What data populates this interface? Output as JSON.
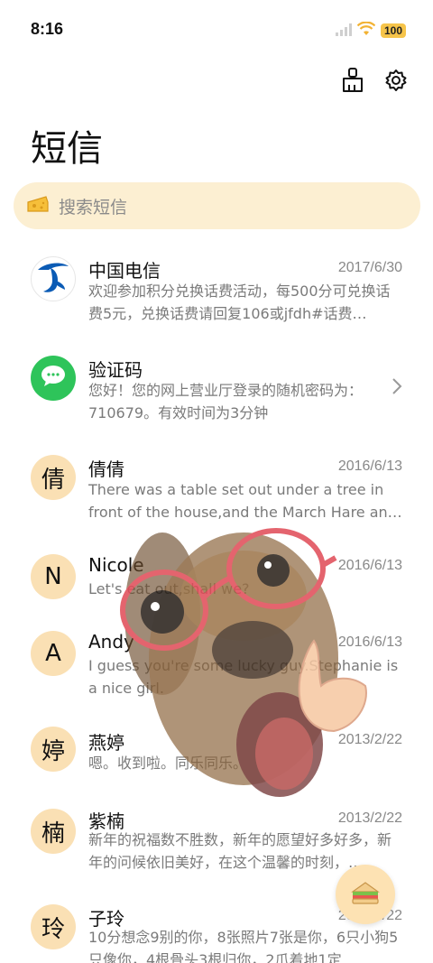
{
  "status_bar": {
    "time": "8:16",
    "battery": "100"
  },
  "header": {
    "title": "短信"
  },
  "search": {
    "placeholder": "搜索短信"
  },
  "messages": [
    {
      "sender": "中国电信",
      "date": "2017/6/30",
      "preview": "欢迎参加积分兑换话费活动，每500分可兑换话费5元，兑换话费请回复106或jfdh#话费…",
      "avatar": ""
    },
    {
      "sender": "验证码",
      "date": "",
      "preview": "您好！您的网上营业厅登录的随机密码为：710679。有效时间为3分钟",
      "avatar": ""
    },
    {
      "sender": "倩倩",
      "date": "2016/6/13",
      "preview": "There was a table set out under a tree in front of the house,and the March Hare an…",
      "avatar": "倩"
    },
    {
      "sender": "Nicole",
      "date": "2016/6/13",
      "preview": "Let's eat out,shall we?",
      "avatar": "N"
    },
    {
      "sender": "Andy",
      "date": "2016/6/13",
      "preview": "I guess you're some lucky guy.Stephanie is a nice girl.",
      "avatar": "A"
    },
    {
      "sender": "燕婷",
      "date": "2013/2/22",
      "preview": "嗯。收到啦。同乐同乐。",
      "avatar": "婷"
    },
    {
      "sender": "紫楠",
      "date": "2013/2/22",
      "preview": "新年的祝福数不胜数，新年的愿望好多好多，新年的问候依旧美好，在这个温馨的时刻，…",
      "avatar": "楠"
    },
    {
      "sender": "子玲",
      "date": "2013/2/22",
      "preview": "10分想念9别的你，8张照片7张是你，6只小狗5只像你，4根骨头3根归你，2爪着地1定…",
      "avatar": "玲"
    }
  ],
  "colors": {
    "accent": "#f6c44a",
    "search_bg": "#fcefd2",
    "avatar_bg": "#fae0b4",
    "green": "#2ec45a",
    "telecom_blue": "#0b5bb5"
  }
}
